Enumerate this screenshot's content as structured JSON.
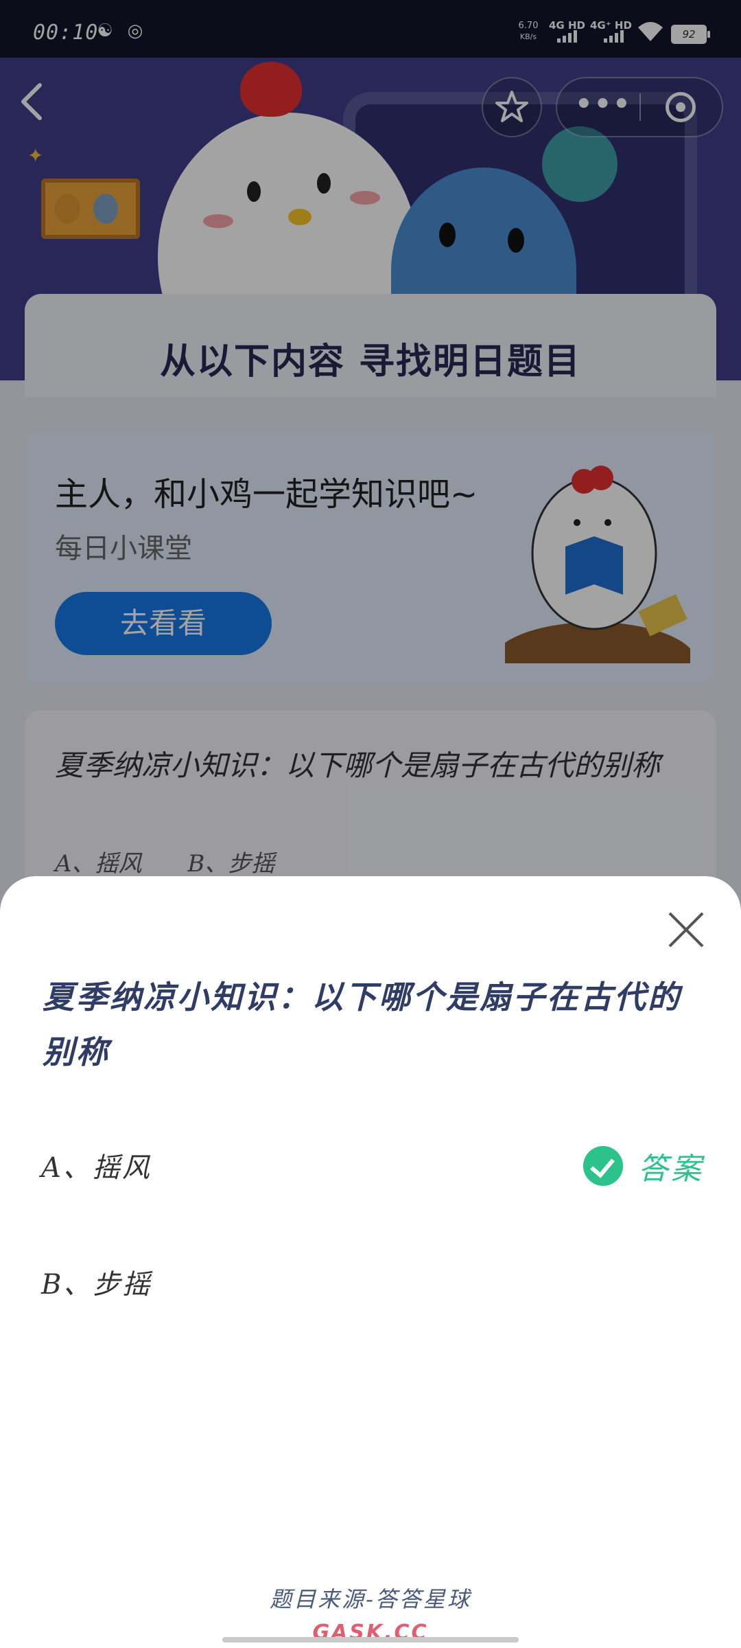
{
  "status_bar": {
    "time": "00:10",
    "net_speed_value": "6.70",
    "net_speed_unit": "KB/s",
    "sim1": "4G HD",
    "sim2": "4G⁺ HD",
    "battery": "92"
  },
  "banner": {
    "heading": "从以下内容 寻找明日题目"
  },
  "learn_card": {
    "title": "主人，和小鸡一起学知识吧~",
    "subtitle": "每日小课堂",
    "button": "去看看"
  },
  "quiz_card": {
    "question": "夏季纳凉小知识：以下哪个是扇子在古代的别称",
    "option_a": "A、摇风",
    "option_b": "B、步摇"
  },
  "sheet": {
    "question": "夏季纳凉小知识：以下哪个是扇子在古代的别称",
    "option_a": "A、摇风",
    "option_b": "B、步摇",
    "answer_label": "答案",
    "source": "题目来源-答答星球",
    "watermark": "GASK.CC"
  },
  "colors": {
    "accent_green": "#2bc28b",
    "button_blue": "#1677e6",
    "question_navy": "#2f3c66"
  }
}
